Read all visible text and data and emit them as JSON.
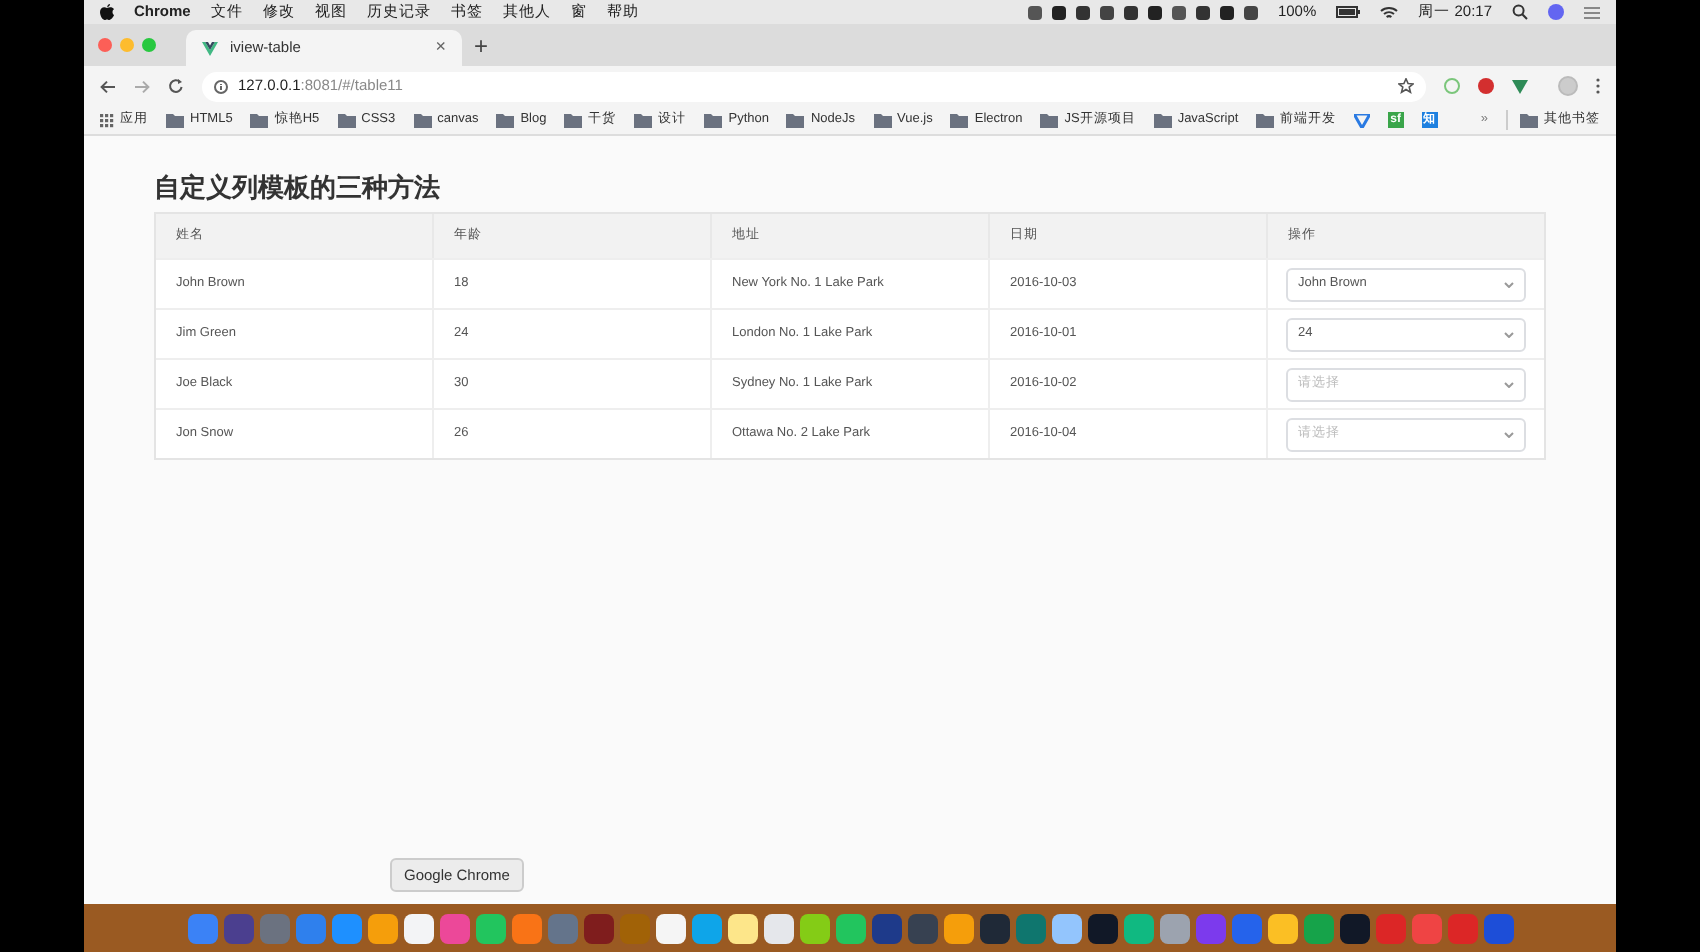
{
  "menu_bar": {
    "app": "Chrome",
    "menus": [
      "文件",
      "修改",
      "视图",
      "历史记录",
      "书签",
      "其他人",
      "窗",
      "帮助"
    ],
    "battery": "100%",
    "clock": "周一 20:17"
  },
  "tab": {
    "title": "iview-table",
    "close": "×"
  },
  "new_tab": "+",
  "address": {
    "host": "127.0.0.1",
    "path": ":8081/#/table11"
  },
  "bookmarks": [
    {
      "label": "应用",
      "kind": "apps"
    },
    {
      "label": "HTML5",
      "kind": "folder"
    },
    {
      "label": "惊艳H5",
      "kind": "folder"
    },
    {
      "label": "CSS3",
      "kind": "folder"
    },
    {
      "label": "canvas",
      "kind": "folder"
    },
    {
      "label": "Blog",
      "kind": "folder"
    },
    {
      "label": "干货",
      "kind": "folder"
    },
    {
      "label": "设计",
      "kind": "folder"
    },
    {
      "label": "Python",
      "kind": "folder"
    },
    {
      "label": "NodeJs",
      "kind": "folder"
    },
    {
      "label": "Vue.js",
      "kind": "folder"
    },
    {
      "label": "Electron",
      "kind": "folder"
    },
    {
      "label": "JS开源项目",
      "kind": "folder"
    },
    {
      "label": "JavaScript",
      "kind": "folder"
    },
    {
      "label": "前端开发",
      "kind": "folder"
    },
    {
      "kind": "icon"
    },
    {
      "label": "sf",
      "kind": "badge",
      "color": "#3aa54a"
    },
    {
      "label": "知",
      "kind": "badge",
      "color": "#1e80e0"
    }
  ],
  "bookmarks_overflow": "»",
  "other_bookmarks": "其他书签",
  "page": {
    "title": "自定义列模板的三种方法",
    "columns": [
      "姓名",
      "年龄",
      "地址",
      "日期",
      "操作"
    ],
    "rows": [
      {
        "name": "John Brown",
        "age": "18",
        "address": "New York No. 1 Lake Park",
        "date": "2016-10-03",
        "select": {
          "value": "John Brown"
        }
      },
      {
        "name": "Jim Green",
        "age": "24",
        "address": "London No. 1 Lake Park",
        "date": "2016-10-01",
        "select": {
          "value": "24"
        }
      },
      {
        "name": "Joe Black",
        "age": "30",
        "address": "Sydney No. 1 Lake Park",
        "date": "2016-10-02",
        "select": {
          "placeholder": "请选择"
        }
      },
      {
        "name": "Jon Snow",
        "age": "26",
        "address": "Ottawa No. 2 Lake Park",
        "date": "2016-10-04",
        "select": {
          "placeholder": "请选择"
        }
      }
    ]
  },
  "dock": {
    "tooltip": "Google Chrome"
  }
}
